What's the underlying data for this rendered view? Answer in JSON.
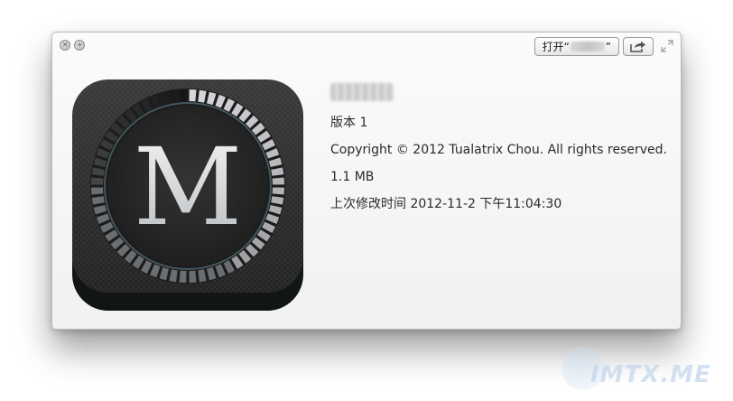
{
  "window": {
    "close_symbol": "×",
    "plus_symbol": "+",
    "open_button": {
      "prefix": "打开“",
      "suffix": "”"
    }
  },
  "icon": {
    "letter": "M",
    "icon_name": "app-icon-m"
  },
  "info": {
    "version": "版本 1",
    "copyright": "Copyright © 2012 Tualatrix Chou. All rights reserved.",
    "size": "1.1 MB",
    "modified": "上次修改时间 2012-11-2 下午11:04:30"
  },
  "watermark": {
    "text": "IMTX.ME"
  },
  "colors": {
    "window_bg": "#f4f4f4",
    "icon_bg": "#2c2c2c",
    "icon_ring": "#9aa4ab",
    "text": "#2a2a2a"
  }
}
